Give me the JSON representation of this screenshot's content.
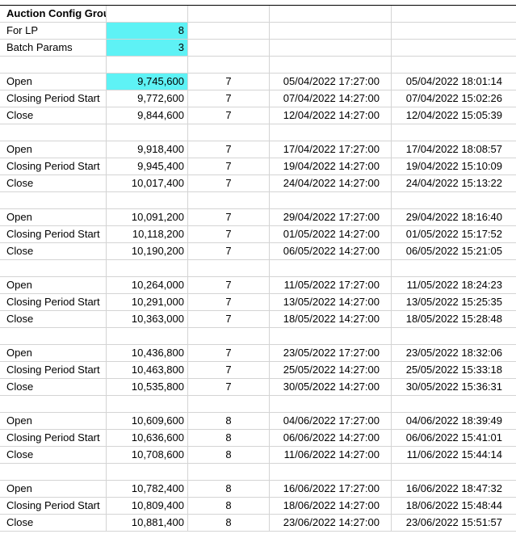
{
  "colors": {
    "highlight": "#5ef2f5",
    "gridline": "#d4d4d4"
  },
  "header": {
    "title": "Auction Config Group"
  },
  "params": [
    {
      "label": "For LP",
      "value": "8"
    },
    {
      "label": "Batch Params",
      "value": "3"
    }
  ],
  "blocks": [
    {
      "rows": [
        {
          "label": "Open",
          "amount": "9,745,600",
          "n": "7",
          "scheduled": "05/04/2022 17:27:00",
          "actual": "05/04/2022 18:01:14",
          "highlight": true
        },
        {
          "label": "Closing Period Start",
          "amount": "9,772,600",
          "n": "7",
          "scheduled": "07/04/2022 14:27:00",
          "actual": "07/04/2022 15:02:26"
        },
        {
          "label": "Close",
          "amount": "9,844,600",
          "n": "7",
          "scheduled": "12/04/2022 14:27:00",
          "actual": "12/04/2022 15:05:39"
        }
      ]
    },
    {
      "rows": [
        {
          "label": "Open",
          "amount": "9,918,400",
          "n": "7",
          "scheduled": "17/04/2022 17:27:00",
          "actual": "17/04/2022 18:08:57"
        },
        {
          "label": "Closing Period Start",
          "amount": "9,945,400",
          "n": "7",
          "scheduled": "19/04/2022 14:27:00",
          "actual": "19/04/2022 15:10:09"
        },
        {
          "label": "Close",
          "amount": "10,017,400",
          "n": "7",
          "scheduled": "24/04/2022 14:27:00",
          "actual": "24/04/2022 15:13:22"
        }
      ]
    },
    {
      "rows": [
        {
          "label": "Open",
          "amount": "10,091,200",
          "n": "7",
          "scheduled": "29/04/2022 17:27:00",
          "actual": "29/04/2022 18:16:40"
        },
        {
          "label": "Closing Period Start",
          "amount": "10,118,200",
          "n": "7",
          "scheduled": "01/05/2022 14:27:00",
          "actual": "01/05/2022 15:17:52"
        },
        {
          "label": "Close",
          "amount": "10,190,200",
          "n": "7",
          "scheduled": "06/05/2022 14:27:00",
          "actual": "06/05/2022 15:21:05"
        }
      ]
    },
    {
      "rows": [
        {
          "label": "Open",
          "amount": "10,264,000",
          "n": "7",
          "scheduled": "11/05/2022 17:27:00",
          "actual": "11/05/2022 18:24:23"
        },
        {
          "label": "Closing Period Start",
          "amount": "10,291,000",
          "n": "7",
          "scheduled": "13/05/2022 14:27:00",
          "actual": "13/05/2022 15:25:35"
        },
        {
          "label": "Close",
          "amount": "10,363,000",
          "n": "7",
          "scheduled": "18/05/2022 14:27:00",
          "actual": "18/05/2022 15:28:48"
        }
      ]
    },
    {
      "rows": [
        {
          "label": "Open",
          "amount": "10,436,800",
          "n": "7",
          "scheduled": "23/05/2022 17:27:00",
          "actual": "23/05/2022 18:32:06"
        },
        {
          "label": "Closing Period Start",
          "amount": "10,463,800",
          "n": "7",
          "scheduled": "25/05/2022 14:27:00",
          "actual": "25/05/2022 15:33:18"
        },
        {
          "label": "Close",
          "amount": "10,535,800",
          "n": "7",
          "scheduled": "30/05/2022 14:27:00",
          "actual": "30/05/2022 15:36:31"
        }
      ]
    },
    {
      "rows": [
        {
          "label": "Open",
          "amount": "10,609,600",
          "n": "8",
          "scheduled": "04/06/2022 17:27:00",
          "actual": "04/06/2022 18:39:49"
        },
        {
          "label": "Closing Period Start",
          "amount": "10,636,600",
          "n": "8",
          "scheduled": "06/06/2022 14:27:00",
          "actual": "06/06/2022 15:41:01"
        },
        {
          "label": "Close",
          "amount": "10,708,600",
          "n": "8",
          "scheduled": "11/06/2022 14:27:00",
          "actual": "11/06/2022 15:44:14"
        }
      ]
    },
    {
      "rows": [
        {
          "label": "Open",
          "amount": "10,782,400",
          "n": "8",
          "scheduled": "16/06/2022 17:27:00",
          "actual": "16/06/2022 18:47:32"
        },
        {
          "label": "Closing Period Start",
          "amount": "10,809,400",
          "n": "8",
          "scheduled": "18/06/2022 14:27:00",
          "actual": "18/06/2022 15:48:44"
        },
        {
          "label": "Close",
          "amount": "10,881,400",
          "n": "8",
          "scheduled": "23/06/2022 14:27:00",
          "actual": "23/06/2022 15:51:57"
        }
      ]
    }
  ]
}
